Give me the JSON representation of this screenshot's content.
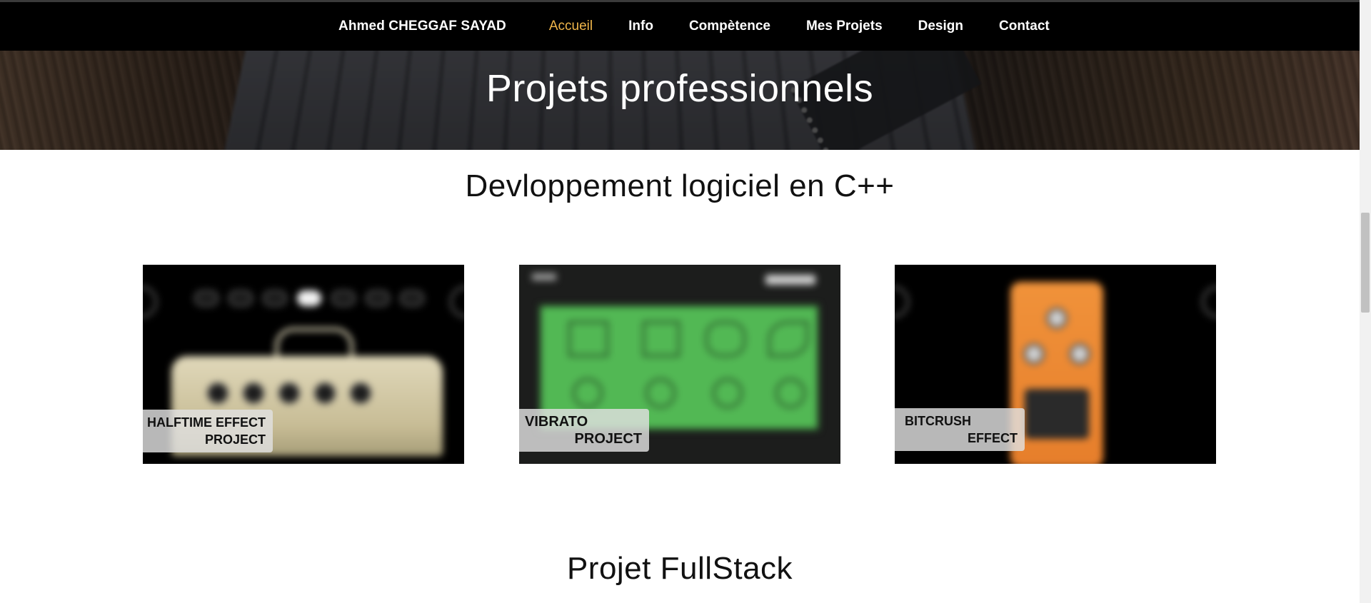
{
  "nav": {
    "brand": "Ahmed CHEGGAF SAYAD",
    "links": [
      {
        "label": "Accueil",
        "active": true
      },
      {
        "label": "Info",
        "active": false
      },
      {
        "label": "Compètence",
        "active": false
      },
      {
        "label": "Mes Projets",
        "active": false
      },
      {
        "label": "Design",
        "active": false
      },
      {
        "label": "Contact",
        "active": false
      }
    ],
    "active_color": "#f0b64a"
  },
  "hero": {
    "title": "Projets professionnels"
  },
  "sections": {
    "cpp_title": "Devloppement logiciel en C++",
    "fullstack_title": "Projet FullStack"
  },
  "cards": [
    {
      "line1": "HALFTIME EFFECT",
      "line2": "PROJECT",
      "image": "amplifier-plugin"
    },
    {
      "line1": "VIBRATO",
      "line2": "PROJECT",
      "image": "vibrato-plugin"
    },
    {
      "line1": "BITCRUSH",
      "line2": "EFFECT",
      "image": "orange-pedal-plugin"
    }
  ],
  "colors": {
    "navbar_bg": "#000000",
    "page_bg": "#ffffff"
  }
}
